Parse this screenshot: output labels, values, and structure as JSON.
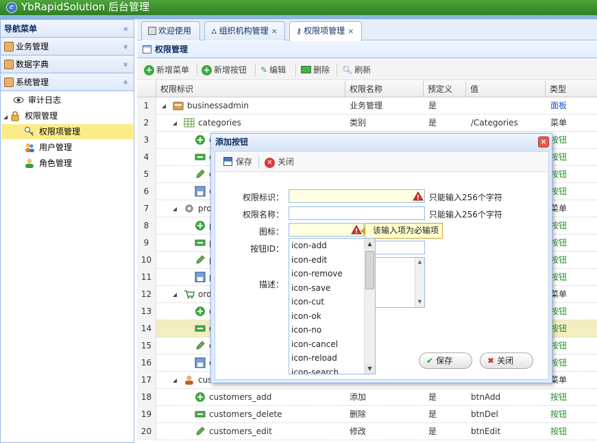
{
  "app": {
    "title": "YbRapidSolution 后台管理",
    "logo_glyph": "e"
  },
  "nav": {
    "header": "导航菜单",
    "collapse_glyph": "«",
    "sections": [
      {
        "label": "业务管理",
        "toggle": "»"
      },
      {
        "label": "数据字典",
        "toggle": "»"
      },
      {
        "label": "系统管理",
        "toggle": "«"
      }
    ],
    "tree": {
      "audit": "审计日志",
      "permission": "权限管理",
      "permission_items": "权限项管理",
      "users": "用户管理",
      "roles": "角色管理"
    }
  },
  "tabs": [
    {
      "label": "欢迎使用"
    },
    {
      "label": "组织机构管理",
      "close": "×"
    },
    {
      "label": "权限项管理",
      "close": "×"
    }
  ],
  "panel": {
    "title": "权限管理"
  },
  "toolbar": {
    "add_menu": "新增菜单",
    "add_button": "新增按钮",
    "edit": "编辑",
    "delete": "删除",
    "refresh": "刷新"
  },
  "grid": {
    "columns": [
      "权限标识",
      "权限名称",
      "预定义",
      "值",
      "类型"
    ],
    "rows": [
      {
        "n": "1",
        "id": "businessadmin",
        "name": "业务管理",
        "pre": "是",
        "val": "",
        "type": "面板"
      },
      {
        "n": "2",
        "id": "categories",
        "name": "类别",
        "pre": "是",
        "val": "/Categories",
        "type": "菜单"
      },
      {
        "n": "3",
        "id": "c",
        "name": "",
        "pre": "",
        "val": "",
        "type": "按钮"
      },
      {
        "n": "4",
        "id": "c",
        "name": "",
        "pre": "",
        "val": "",
        "type": "按钮"
      },
      {
        "n": "5",
        "id": "c",
        "name": "",
        "pre": "",
        "val": "",
        "type": "按钮"
      },
      {
        "n": "6",
        "id": "c",
        "name": "",
        "pre": "",
        "val": "",
        "type": "按钮"
      },
      {
        "n": "7",
        "id": "proc",
        "name": "",
        "pre": "",
        "val": "",
        "type": "菜单"
      },
      {
        "n": "8",
        "id": "p",
        "name": "",
        "pre": "",
        "val": "",
        "type": "按钮"
      },
      {
        "n": "9",
        "id": "p",
        "name": "",
        "pre": "",
        "val": "",
        "type": "按钮"
      },
      {
        "n": "10",
        "id": "p",
        "name": "",
        "pre": "",
        "val": "",
        "type": "按钮"
      },
      {
        "n": "11",
        "id": "p",
        "name": "",
        "pre": "",
        "val": "",
        "type": "按钮"
      },
      {
        "n": "12",
        "id": "orde",
        "name": "",
        "pre": "",
        "val": "",
        "type": "菜单"
      },
      {
        "n": "13",
        "id": "o",
        "name": "",
        "pre": "",
        "val": "",
        "type": "按钮"
      },
      {
        "n": "14",
        "id": "o",
        "name": "",
        "pre": "",
        "val": "",
        "type": "按钮"
      },
      {
        "n": "15",
        "id": "o",
        "name": "",
        "pre": "",
        "val": "",
        "type": "按钮"
      },
      {
        "n": "16",
        "id": "o",
        "name": "",
        "pre": "",
        "val": "",
        "type": "按钮"
      },
      {
        "n": "17",
        "id": "cust",
        "name": "",
        "pre": "",
        "val": "",
        "type": "菜单"
      },
      {
        "n": "18",
        "id": "customers_add",
        "name": "添加",
        "pre": "是",
        "val": "btnAdd",
        "type": "按钮"
      },
      {
        "n": "19",
        "id": "customers_delete",
        "name": "删除",
        "pre": "是",
        "val": "btnDel",
        "type": "按钮"
      },
      {
        "n": "20",
        "id": "customers_edit",
        "name": "修改",
        "pre": "是",
        "val": "btnEdit",
        "type": "按钮"
      }
    ]
  },
  "dialog": {
    "title": "添加按钮",
    "close_glyph": "×",
    "save": "保存",
    "close": "关闭",
    "fields": {
      "perm_id_label": "权限标识：",
      "perm_name_label": "权限名称：",
      "icon_label": "图标：",
      "button_id_label": "按钮ID：",
      "desc_label": "描述：",
      "limit_hint": "只能输入256个字符"
    },
    "tooltip": "该输入项为必输项",
    "icon_options": [
      "icon-add",
      "icon-edit",
      "icon-remove",
      "icon-save",
      "icon-cut",
      "icon-ok",
      "icon-no",
      "icon-cancel",
      "icon-reload",
      "icon-search"
    ],
    "footer_save": "保存",
    "footer_close": "关闭"
  },
  "colors": {
    "header": "#3a8f2c",
    "accent": "#95b8e7",
    "selected": "#fbec88",
    "link_blue": "#1a55c2",
    "button_green": "#2a8a2a"
  }
}
